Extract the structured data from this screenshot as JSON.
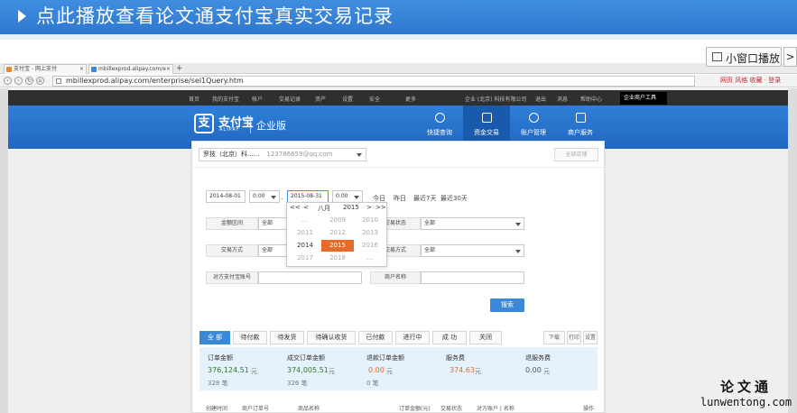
{
  "slide": {
    "title": "点此播放查看论文通支付宝真实交易记录"
  },
  "mini_player": {
    "label": "小窗口播放",
    "arrow": ">"
  },
  "browser": {
    "tabs": [
      {
        "label": "支付宝 - 网上支付"
      },
      {
        "label": "mbillexprod.alipay.com/e"
      }
    ],
    "new_tab": "+",
    "url": "mbillexprod.alipay.com/enterprise/sel1Query.htm",
    "right_text": "网页 风格 收藏 · 登录"
  },
  "topnav": {
    "items": [
      "首页",
      "我的支付宝",
      "帐户",
      "交易记录",
      "资产",
      "设置",
      "安全",
      "更多"
    ],
    "right_items": [
      "企业 (北京) 科技有限公司",
      "退出",
      "消息",
      "帮助中心"
    ],
    "popup": "企业商户工具"
  },
  "brand": {
    "logo_glyph": "支",
    "name": "支付宝",
    "sub": "ALIPAY",
    "edition": "企业版"
  },
  "main_nav": [
    {
      "label": "快捷查询",
      "active": false
    },
    {
      "label": "资金交易",
      "active": true
    },
    {
      "label": "账户管理",
      "active": false
    },
    {
      "label": "商户服务",
      "active": false
    }
  ],
  "account": {
    "name": "罗技（北京）科......",
    "email": "123786659@qq.com"
  },
  "right_button": "全部店铺",
  "date": {
    "start": "2014-08-01",
    "start_time": "0:00",
    "separator": "-",
    "end": "2015-08-31",
    "end_time": "0:00",
    "quick": [
      "今日",
      "昨日",
      "最近7天",
      "最近30天"
    ]
  },
  "calendar": {
    "nav_prev2": "<<",
    "nav_prev": "<",
    "month": "八月",
    "year": "2015",
    "nav_next": ">",
    "nav_next2": ">>",
    "years": [
      "...",
      "2009",
      "2010",
      "2011",
      "2012",
      "2013",
      "2014",
      "2015",
      "2016",
      "2017",
      "2018",
      "..."
    ],
    "selected": "2015"
  },
  "form": {
    "amount_label": "金额区间",
    "amount_value": "全部",
    "status_label": "交易状态",
    "status_value": "全部",
    "period_label": "交易方式",
    "period_value": "全部",
    "channel_label": "交易方式",
    "channel_value": "全部",
    "alipay_label": "对方支付宝账号",
    "merchant_label": "商户名称",
    "search_button": "搜索"
  },
  "filter_tabs": [
    "全 部",
    "待付款",
    "待发货",
    "待确认收货",
    "已付款",
    "进行中",
    "成 功",
    "关闭"
  ],
  "tools": [
    "下载",
    "打印",
    "设置"
  ],
  "summary": [
    {
      "label": "订单金额",
      "value": "376,124.51",
      "unit": "元",
      "count": "328 笔",
      "color": "#2d7d1e"
    },
    {
      "label": "成交订单金额",
      "value": "374,005.51",
      "unit": "元",
      "count": "326 笔",
      "color": "#2d7d1e"
    },
    {
      "label": "退款订单金额",
      "value": "0.00",
      "unit": "元",
      "count": "0 笔",
      "color": "#e86a2a"
    },
    {
      "label": "服务费",
      "value": "374.63",
      "unit": "元",
      "count": "",
      "color": "#e86a2a"
    },
    {
      "label": "退服务费",
      "value": "0.00",
      "unit": "元",
      "count": "",
      "color": "#555555"
    }
  ],
  "table_headers": [
    "创建时间",
    "商户订单号",
    "商品名称",
    "订单金额(元)",
    "交易状态",
    "对方账户 | 名称",
    "操作"
  ],
  "watermark": {
    "cn": "论文通",
    "en": "lunwentong.com"
  }
}
